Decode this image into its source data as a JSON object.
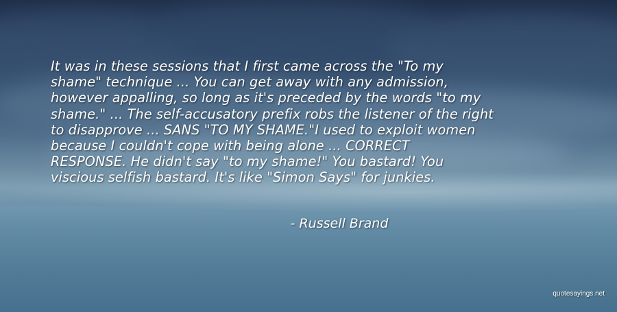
{
  "quote": {
    "lines": [
      "It was in these sessions that I first came across the \"To my",
      "shame\" technique ... You can get away with any admission,",
      "however appalling, so long as it's preceded by the words \"to my",
      "shame.\" ... The self-accusatory prefix robs the listener of the right",
      "to disapprove ... SANS \"TO MY SHAME.\"I used to exploit women",
      "because I couldn't cope with being alone ... CORRECT",
      "RESPONSE. He didn't say \"to my shame!\" You bastard! You",
      "viscious selfish bastard. It's like \"Simon Says\" for junkies."
    ],
    "author": "- Russell Brand"
  },
  "watermark": "quotesayings.net"
}
